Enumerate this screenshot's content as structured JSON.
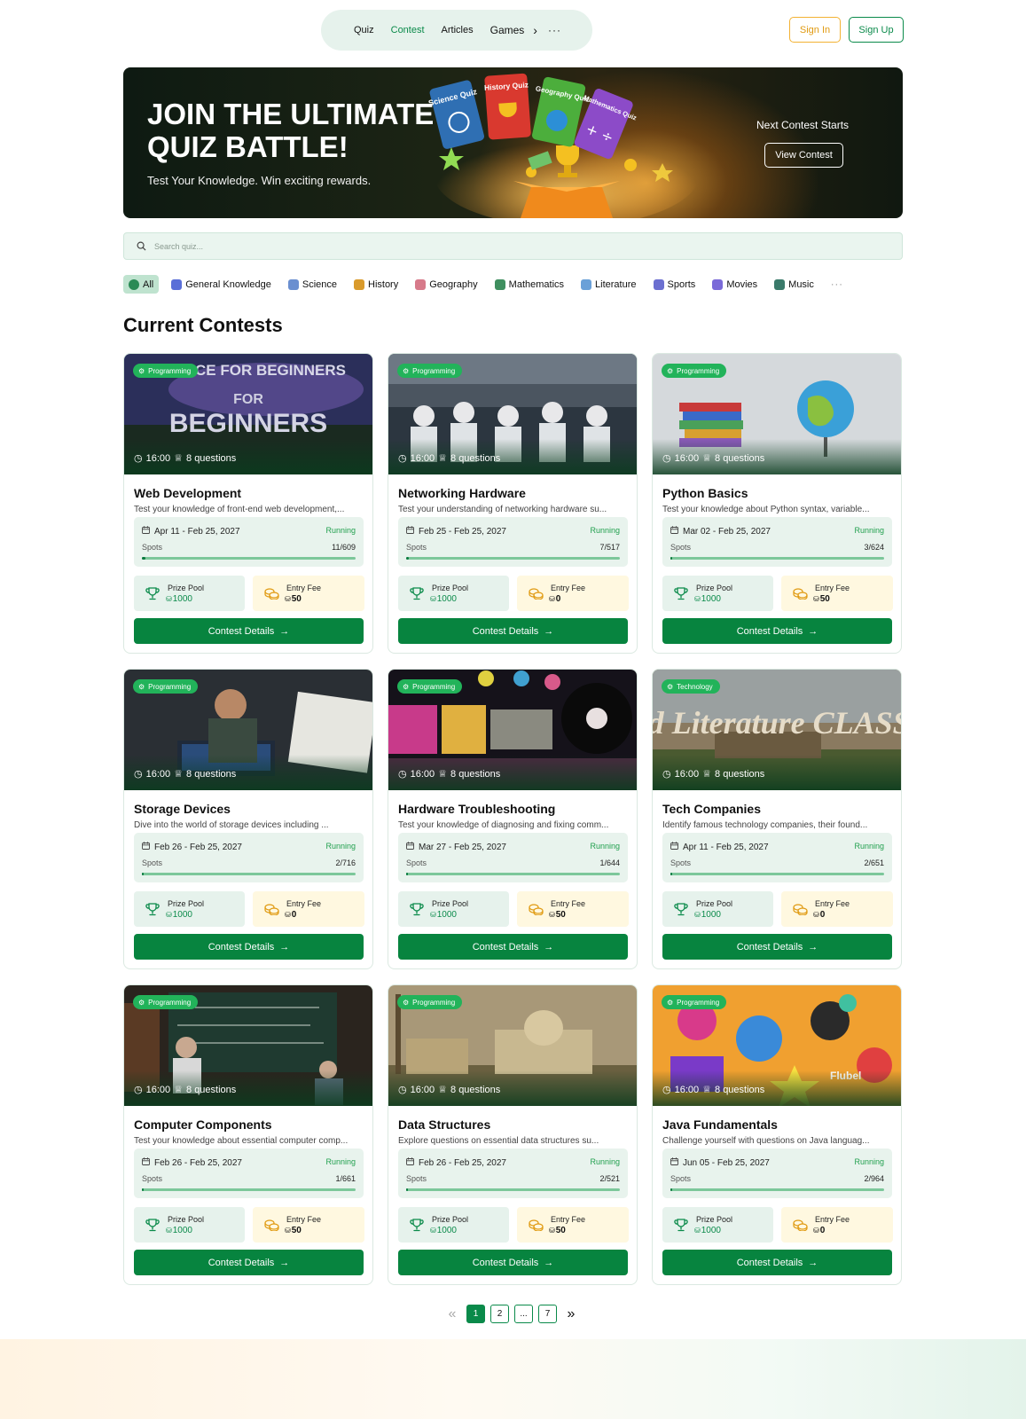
{
  "nav": {
    "links": [
      "Quiz",
      "Contest",
      "Articles",
      "Games"
    ],
    "active": "Contest"
  },
  "auth": {
    "sign_in": "Sign In",
    "sign_up": "Sign Up"
  },
  "hero": {
    "title": "JOIN THE ULTIMATE QUIZ BATTLE!",
    "subtitle": "Test Your Knowledge. Win exciting rewards.",
    "next_label": "Next Contest Starts",
    "button": "View Contest",
    "card_labels": [
      "Science Quiz",
      "History Quiz",
      "Geography Quiz",
      "Mathematics Quiz"
    ]
  },
  "search": {
    "placeholder": "Search quiz..."
  },
  "categories": [
    {
      "label": "All",
      "color": "#2a8a55"
    },
    {
      "label": "General Knowledge",
      "color": "#5a6fd8"
    },
    {
      "label": "Science",
      "color": "#6a8fd0"
    },
    {
      "label": "History",
      "color": "#d99a2b"
    },
    {
      "label": "Geography",
      "color": "#d77a8a"
    },
    {
      "label": "Mathematics",
      "color": "#3f8f5f"
    },
    {
      "label": "Literature",
      "color": "#6aa0d8"
    },
    {
      "label": "Sports",
      "color": "#6b6fd0"
    },
    {
      "label": "Movies",
      "color": "#7a6ad8"
    },
    {
      "label": "Music",
      "color": "#3a7a6a"
    }
  ],
  "section_title": "Current Contests",
  "contests": [
    {
      "tag": "Programming",
      "time": "16:00",
      "questions": "8 questions",
      "title": "Web Development",
      "desc": "Test your knowledge of front-end web development,...",
      "date": "Apr 11 - Feb 25, 2027",
      "status": "Running",
      "spots_label": "Spots",
      "spots": "11/609",
      "progress": 0.018,
      "prize_label": "Prize Pool",
      "prize": "1000",
      "fee_label": "Entry Fee",
      "fee": "50",
      "cta": "Contest Details",
      "image_text": "CE FOR BEGINNERS FOR BEGINNERS"
    },
    {
      "tag": "Programming",
      "time": "16:00",
      "questions": "8 questions",
      "title": "Networking Hardware",
      "desc": "Test your understanding of networking hardware su...",
      "date": "Feb 25 - Feb 25, 2027",
      "status": "Running",
      "spots_label": "Spots",
      "spots": "7/517",
      "progress": 0.014,
      "prize_label": "Prize Pool",
      "prize": "1000",
      "fee_label": "Entry Fee",
      "fee": "0",
      "cta": "Contest Details",
      "image_text": ""
    },
    {
      "tag": "Programming",
      "time": "16:00",
      "questions": "8 questions",
      "title": "Python Basics",
      "desc": "Test your knowledge about Python syntax, variable...",
      "date": "Mar 02 - Feb 25, 2027",
      "status": "Running",
      "spots_label": "Spots",
      "spots": "3/624",
      "progress": 0.005,
      "prize_label": "Prize Pool",
      "prize": "1000",
      "fee_label": "Entry Fee",
      "fee": "50",
      "cta": "Contest Details",
      "image_text": ""
    },
    {
      "tag": "Programming",
      "time": "16:00",
      "questions": "8 questions",
      "title": "Storage Devices",
      "desc": "Dive into the world of storage devices including ...",
      "date": "Feb 26 - Feb 25, 2027",
      "status": "Running",
      "spots_label": "Spots",
      "spots": "2/716",
      "progress": 0.003,
      "prize_label": "Prize Pool",
      "prize": "1000",
      "fee_label": "Entry Fee",
      "fee": "0",
      "cta": "Contest Details",
      "image_text": ""
    },
    {
      "tag": "Programming",
      "time": "16:00",
      "questions": "8 questions",
      "title": "Hardware Troubleshooting",
      "desc": "Test your knowledge of diagnosing and fixing comm...",
      "date": "Mar 27 - Feb 25, 2027",
      "status": "Running",
      "spots_label": "Spots",
      "spots": "1/644",
      "progress": 0.002,
      "prize_label": "Prize Pool",
      "prize": "1000",
      "fee_label": "Entry Fee",
      "fee": "50",
      "cta": "Contest Details",
      "image_text": ""
    },
    {
      "tag": "Technology",
      "time": "16:00",
      "questions": "8 questions",
      "title": "Tech Companies",
      "desc": "Identify famous technology companies, their found...",
      "date": "Apr 11 - Feb 25, 2027",
      "status": "Running",
      "spots_label": "Spots",
      "spots": "2/651",
      "progress": 0.003,
      "prize_label": "Prize Pool",
      "prize": "1000",
      "fee_label": "Entry Fee",
      "fee": "0",
      "cta": "Contest Details",
      "image_text": "World Literature CLASSICS"
    },
    {
      "tag": "Programming",
      "time": "16:00",
      "questions": "8 questions",
      "title": "Computer Components",
      "desc": "Test your knowledge about essential computer comp...",
      "date": "Feb 26 - Feb 25, 2027",
      "status": "Running",
      "spots_label": "Spots",
      "spots": "1/661",
      "progress": 0.002,
      "prize_label": "Prize Pool",
      "prize": "1000",
      "fee_label": "Entry Fee",
      "fee": "50",
      "cta": "Contest Details",
      "image_text": ""
    },
    {
      "tag": "Programming",
      "time": "16:00",
      "questions": "8 questions",
      "title": "Data Structures",
      "desc": "Explore questions on essential data structures su...",
      "date": "Feb 26 - Feb 25, 2027",
      "status": "Running",
      "spots_label": "Spots",
      "spots": "2/521",
      "progress": 0.004,
      "prize_label": "Prize Pool",
      "prize": "1000",
      "fee_label": "Entry Fee",
      "fee": "50",
      "cta": "Contest Details",
      "image_text": ""
    },
    {
      "tag": "Programming",
      "time": "16:00",
      "questions": "8 questions",
      "title": "Java Fundamentals",
      "desc": "Challenge yourself with questions on Java languag...",
      "date": "Jun 05 - Feb 25, 2027",
      "status": "Running",
      "spots_label": "Spots",
      "spots": "2/964",
      "progress": 0.002,
      "prize_label": "Prize Pool",
      "prize": "1000",
      "fee_label": "Entry Fee",
      "fee": "0",
      "cta": "Contest Details",
      "image_text": "Flubel"
    }
  ],
  "pagination": {
    "pages": [
      "1",
      "2",
      "...",
      "7"
    ],
    "current": "1"
  },
  "colors": {
    "brand": "#0a8a4a",
    "accent": "#f3b233",
    "running": "#22a04f"
  }
}
